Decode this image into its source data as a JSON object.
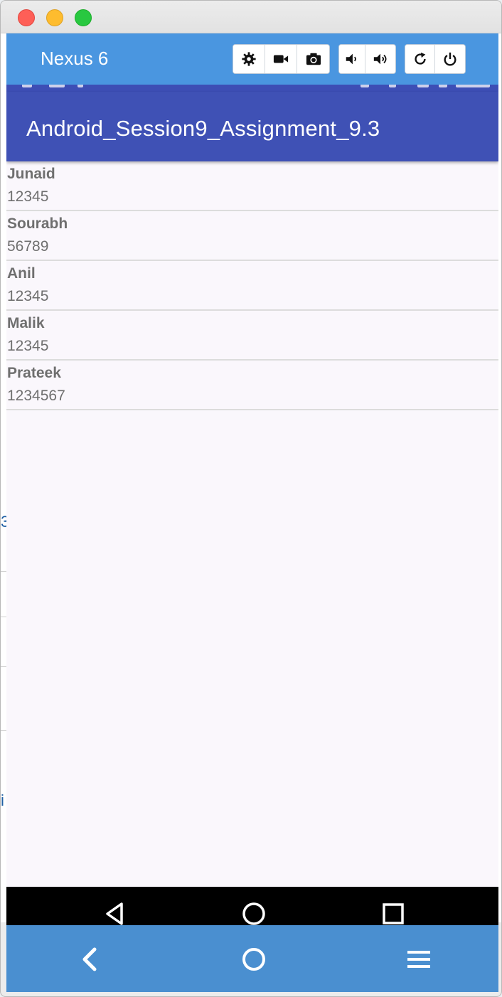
{
  "window": {
    "controls": [
      "close",
      "minimize",
      "zoom"
    ]
  },
  "toolbar": {
    "device_name": "Nexus 6",
    "buttons": [
      {
        "icon": "gear-icon"
      },
      {
        "icon": "video-camera-icon"
      },
      {
        "icon": "camera-icon"
      },
      {
        "icon": "volume-down-icon"
      },
      {
        "icon": "volume-up-icon"
      },
      {
        "icon": "rotate-icon"
      },
      {
        "icon": "power-icon"
      }
    ]
  },
  "app": {
    "title": "Android_Session9_Assignment_9.3"
  },
  "contacts": [
    {
      "name": "Junaid",
      "number": "12345"
    },
    {
      "name": "Sourabh",
      "number": "56789"
    },
    {
      "name": "Anil",
      "number": "12345"
    },
    {
      "name": "Malik",
      "number": "12345"
    },
    {
      "name": "Prateek",
      "number": "1234567"
    }
  ],
  "navbar": {
    "buttons": [
      "back-icon",
      "home-icon",
      "recents-icon"
    ]
  },
  "bottombar": {
    "buttons": [
      "chevron-left-icon",
      "circle-home-icon",
      "menu-icon"
    ]
  },
  "colors": {
    "emulator_toolbar": "#4a96e0",
    "app_bar": "#3f51b5",
    "screen_bg": "#faf7fc",
    "bottom_bar": "#4a8fd0"
  },
  "background_page": {
    "mark_1": "3",
    "mark_2": "i"
  }
}
